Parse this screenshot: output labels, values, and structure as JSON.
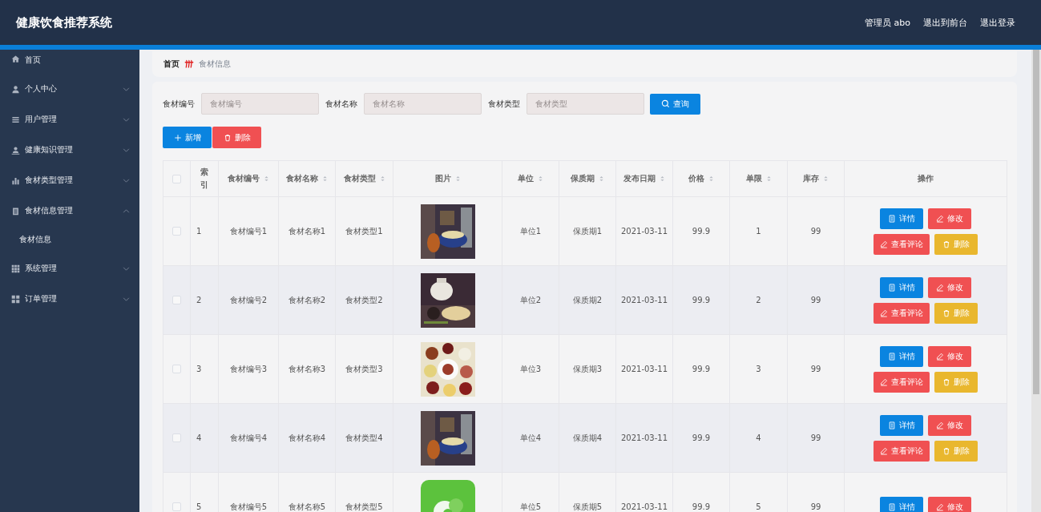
{
  "header": {
    "title": "健康饮食推荐系统",
    "links": [
      "管理员 abo",
      "退出到前台",
      "退出登录"
    ]
  },
  "sidebar": {
    "items": [
      {
        "label": "首页"
      },
      {
        "label": "个人中心",
        "expanded": false
      },
      {
        "label": "用户管理",
        "expanded": false
      },
      {
        "label": "健康知识管理",
        "expanded": false
      },
      {
        "label": "食材类型管理",
        "expanded": false
      },
      {
        "label": "食材信息管理",
        "expanded": true,
        "children": [
          {
            "label": "食材信息"
          }
        ]
      },
      {
        "label": "系统管理",
        "expanded": false
      },
      {
        "label": "订单管理",
        "expanded": false
      }
    ]
  },
  "breadcrumb": [
    "首页",
    "食材信息"
  ],
  "search": {
    "fields": [
      {
        "label": "食材编号",
        "placeholder": "食材编号"
      },
      {
        "label": "食材名称",
        "placeholder": "食材名称"
      },
      {
        "label": "食材类型",
        "placeholder": "食材类型"
      }
    ],
    "button": "查询"
  },
  "actions": [
    {
      "kind": "add",
      "label": "新增"
    },
    {
      "kind": "delete",
      "label": "删除"
    }
  ],
  "table": {
    "columns": [
      {
        "kind": "check",
        "checked": false
      },
      {
        "label": "索引",
        "sortable": false
      },
      {
        "label": "食材编号",
        "sortable": true
      },
      {
        "label": "食材名称",
        "sortable": true
      },
      {
        "label": "食材类型",
        "sortable": true
      },
      {
        "label": "图片",
        "sortable": true
      },
      {
        "label": "单位",
        "sortable": true
      },
      {
        "label": "保质期",
        "sortable": true
      },
      {
        "label": "发布日期",
        "sortable": true
      },
      {
        "label": "价格",
        "sortable": true
      },
      {
        "label": "单限",
        "sortable": true
      },
      {
        "label": "库存",
        "sortable": true
      },
      {
        "label": "操作",
        "sortable": false
      }
    ],
    "rows": [
      {
        "cells": [
          {
            "checked": false
          },
          "1",
          "食材编号1",
          "食材名称1",
          "食材类型1",
          {
            "kind": "picture"
          },
          "单位1",
          "保质期1",
          "2021-03-11",
          "99.9",
          "1",
          "99",
          [
            {
              "kind": "detail",
              "label": "详情"
            },
            {
              "kind": "edit",
              "label": "修改"
            },
            {
              "kind": "review",
              "label": "查看评论"
            },
            {
              "kind": "delete",
              "label": "删除"
            }
          ]
        ]
      },
      {
        "cells": [
          {
            "checked": false
          },
          "2",
          "食材编号2",
          "食材名称2",
          "食材类型2",
          {
            "kind": "picture"
          },
          "单位2",
          "保质期2",
          "2021-03-11",
          "99.9",
          "2",
          "99",
          [
            {
              "kind": "detail",
              "label": "详情"
            },
            {
              "kind": "edit",
              "label": "修改"
            },
            {
              "kind": "review",
              "label": "查看评论"
            },
            {
              "kind": "delete",
              "label": "删除"
            }
          ]
        ]
      },
      {
        "cells": [
          {
            "checked": false
          },
          "3",
          "食材编号3",
          "食材名称3",
          "食材类型3",
          {
            "kind": "picture"
          },
          "单位3",
          "保质期3",
          "2021-03-11",
          "99.9",
          "3",
          "99",
          [
            {
              "kind": "detail",
              "label": "详情"
            },
            {
              "kind": "edit",
              "label": "修改"
            },
            {
              "kind": "review",
              "label": "查看评论"
            },
            {
              "kind": "delete",
              "label": "删除"
            }
          ]
        ]
      },
      {
        "cells": [
          {
            "checked": false
          },
          "4",
          "食材编号4",
          "食材名称4",
          "食材类型4",
          {
            "kind": "picture"
          },
          "单位4",
          "保质期4",
          "2021-03-11",
          "99.9",
          "4",
          "99",
          [
            {
              "kind": "detail",
              "label": "详情"
            },
            {
              "kind": "edit",
              "label": "修改"
            },
            {
              "kind": "review",
              "label": "查看评论"
            },
            {
              "kind": "delete",
              "label": "删除"
            }
          ]
        ]
      },
      {
        "cells": [
          {
            "checked": false
          },
          "5",
          "食材编号5",
          "食材名称5",
          "食材类型5",
          {
            "kind": "picture"
          },
          "单位5",
          "保质期5",
          "2021-03-11",
          "99.9",
          "5",
          "99",
          [
            {
              "kind": "detail",
              "label": "详情"
            },
            {
              "kind": "edit",
              "label": "修改"
            }
          ]
        ]
      }
    ]
  }
}
